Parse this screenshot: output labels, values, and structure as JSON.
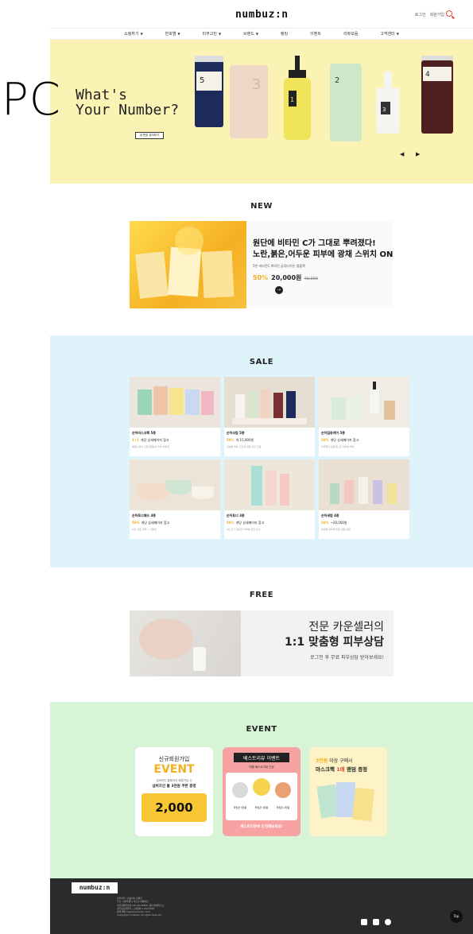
{
  "overlay_label": "PC",
  "header": {
    "logo": "numbuz:n",
    "links": [
      "로그인",
      "회원가입"
    ]
  },
  "nav": [
    {
      "label": "쇼핑하기"
    },
    {
      "label": "번호별"
    },
    {
      "label": "피부고민"
    },
    {
      "label": "브랜드"
    },
    {
      "label": "랭킹"
    },
    {
      "label": "이벤트"
    },
    {
      "label": "리뷰모음"
    },
    {
      "label": "고객센터"
    }
  ],
  "hero": {
    "title": "What's\nYour Number?",
    "button": "내 번호 찾아보기",
    "prev": "◀",
    "next": "▶",
    "product_numbers": [
      "5",
      "3",
      "1",
      "2",
      "3",
      "4"
    ]
  },
  "new_section": {
    "title": "NEW",
    "headline_1": "원단에 비타민 C가 그대로 뿌려졌다!",
    "headline_2": "노란,붉은,어두운 피부에 광채 스위치 ON",
    "sub": "5번 비타민C 뿌려진 글루타치온 앰플팩",
    "discount": "50%",
    "price": "20,000원",
    "original_price": "40,000"
  },
  "sale_section": {
    "title": "SALE",
    "items": [
      {
        "name": "순하마스크팩 5종",
        "pct": "1+1",
        "price": "개당 상세페이지 참고",
        "desc": "헤일스에서 스토리텔링의 피부 솔루션"
      },
      {
        "name": "순하크림 5종",
        "pct": "50%",
        "price": "약 15,000원",
        "desc": "번호별 피부 고민에 맞춘 순한 크림"
      },
      {
        "name": "순하집중케어 5종",
        "pct": "50%",
        "price": "개당 상세페이지 참고",
        "desc": "자극없이 집중적으로 피부를 케어"
      },
      {
        "name": "순하토너패드 4종",
        "pct": "50%",
        "price": "개당 상세페이지 참고",
        "desc": "하나 기준 하루 1 가볍게"
      },
      {
        "name": "순하토너 3종",
        "pct": "50%",
        "price": "개당 상세페이지 참고",
        "desc": "마스크가 필요한 피부를 위한 토너"
      },
      {
        "name": "순하세럼 4종",
        "pct": "50%",
        "price": "~20,000원",
        "desc": "번호별 피부에 맞춘 집중 세럼"
      }
    ]
  },
  "free_section": {
    "title": "FREE",
    "line1": "전문 카운셀러의",
    "line2": "1:1 맞춤형 피부상담",
    "line3": "로그인 후 무료 피부상담 받아보세요!"
  },
  "event_section": {
    "title": "EVENT",
    "card1": {
      "t1": "신규회원가입",
      "t2": "EVENT",
      "t3": "넘버즈인 홈페이지 회원가입 시",
      "t4": "넘버즈인 몰 3천원 쿠폰 증정",
      "t5": "2,000"
    },
    "card2": {
      "t1": "베스트리뷰 이벤트",
      "t2": "매월 베스트리뷰 선정",
      "t3": "적립금 5천원",
      "t4": "적립금 3천원",
      "t5": "적립금 2천원",
      "t6": "베스트리뷰에 도전해보세요!"
    },
    "card3": {
      "t1": "3만원",
      "t2": "이상 구매시",
      "t3": "마스크팩",
      "t4": "1매",
      "t5": "랜덤 증정"
    }
  },
  "footer": {
    "logo": "numbuz:n",
    "lines": [
      "비플레인 | 대표이사 공채훈",
      "주소: 서울특별시 강남구 테헤란로",
      "사업자등록번호 123-45-67890 | 통신판매업신고",
      "개인정보책임자 | 고객센터 1234-5678",
      "문의 메일 help@numbuzin.com",
      "Copyright numbuzin. All rights reserved."
    ],
    "top_button": "Top"
  },
  "colors": {
    "hero_bg": "#fbf3b3",
    "sale_bg": "#dff3fb",
    "event_bg": "#d8f4d6",
    "footer_bg": "#2b2b2b",
    "accent": "#f2b01e"
  }
}
